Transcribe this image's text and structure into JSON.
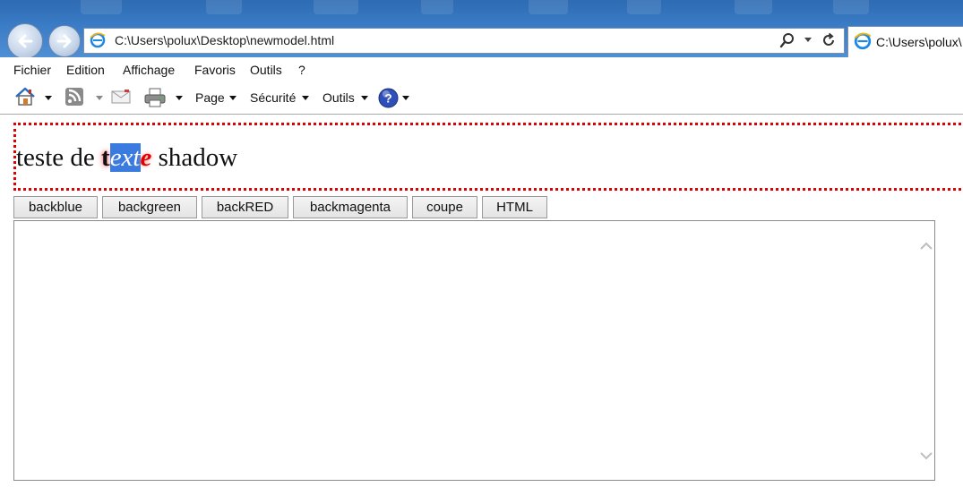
{
  "browser": {
    "address": "C:\\Users\\polux\\Desktop\\newmodel.html",
    "tab_title": "C:\\Users\\polux\\"
  },
  "menu": [
    "Fichier",
    "Edition",
    "Affichage",
    "Favoris",
    "Outils",
    "?"
  ],
  "commandbar": {
    "page_label": "Page",
    "security_label": "Sécurité",
    "tools_label": "Outils",
    "icons": [
      "home-icon",
      "rss-feed-icon",
      "read-mail-icon",
      "print-icon",
      "help-icon"
    ]
  },
  "content": {
    "heading": {
      "before": "teste de ",
      "t": "t",
      "selected": "ext",
      "e": "e",
      "after": " shadow"
    },
    "buttons": [
      "backblue",
      "backgreen",
      "backRED",
      "backmagenta",
      "coupe",
      "HTML"
    ],
    "editor_text": ""
  },
  "colors": {
    "chrome_blue": "#3b7cc6",
    "dotted_border": "#e00000",
    "selection": "#3b7be0",
    "ie_logo": "#1e88e5"
  }
}
